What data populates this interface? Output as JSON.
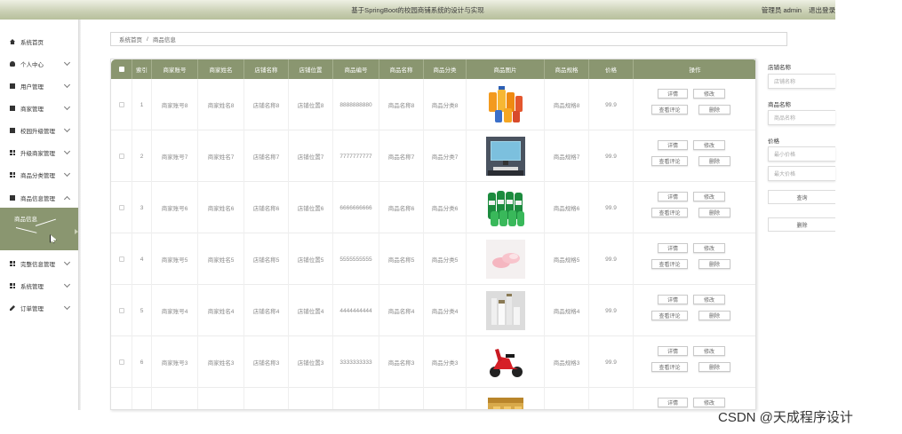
{
  "header": {
    "title": "基于SpringBoot的校园商铺系统的设计与实现",
    "user_label": "管理员 admin",
    "logout": "退出登录"
  },
  "sidebar": {
    "items": [
      {
        "label": "系统首页",
        "icon": "home-icon",
        "chevron": false
      },
      {
        "label": "个人中心",
        "icon": "person-icon",
        "chevron": true
      },
      {
        "label": "用户管理",
        "icon": "list-icon",
        "chevron": true
      },
      {
        "label": "商家管理",
        "icon": "store-icon",
        "chevron": true
      },
      {
        "label": "校园升级管理",
        "icon": "upgrade-icon",
        "chevron": true
      },
      {
        "label": "升级商家管理",
        "icon": "grid-icon",
        "chevron": true
      },
      {
        "label": "商品分类管理",
        "icon": "grid-icon",
        "chevron": true
      },
      {
        "label": "商品信息管理",
        "icon": "store-icon",
        "chevron": true
      },
      {
        "label": "完整信息管理",
        "icon": "grid-icon",
        "chevron": true
      },
      {
        "label": "系统管理",
        "icon": "grid-icon",
        "chevron": true
      },
      {
        "label": "订单管理",
        "icon": "pen-icon",
        "chevron": true
      }
    ],
    "submenu_label": "商品信息"
  },
  "breadcrumb": {
    "home": "系统首页",
    "separator": "/",
    "current": "商品信息"
  },
  "table": {
    "headers": [
      "索引",
      "商家账号",
      "商家姓名",
      "店铺名称",
      "店铺位置",
      "商品编号",
      "商品名称",
      "商品分类",
      "商品图片",
      "商品规格",
      "价格",
      "操作"
    ],
    "rows": [
      {
        "index": "1",
        "account": "商家账号8",
        "name": "商家姓名8",
        "shop": "店铺名称8",
        "location": "店铺位置8",
        "code": "8888888880",
        "product": "商品名称8",
        "category": "商品分类8",
        "image": "drinks",
        "spec": "商品规格8",
        "price": "99.9"
      },
      {
        "index": "2",
        "account": "商家账号7",
        "name": "商家姓名7",
        "shop": "店铺名称7",
        "location": "店铺位置7",
        "code": "7777777777",
        "product": "商品名称7",
        "category": "商品分类7",
        "image": "computer",
        "spec": "商品规格7",
        "price": "99.9"
      },
      {
        "index": "3",
        "account": "商家账号6",
        "name": "商家姓名6",
        "shop": "店铺名称6",
        "location": "店铺位置6",
        "code": "6666666666",
        "product": "商品名称6",
        "category": "商品分类6",
        "image": "bottles",
        "spec": "商品规格6",
        "price": "99.9"
      },
      {
        "index": "4",
        "account": "商家账号5",
        "name": "商家姓名5",
        "shop": "店铺名称5",
        "location": "店铺位置5",
        "code": "5555555555",
        "product": "商品名称5",
        "category": "商品分类5",
        "image": "slippers",
        "spec": "商品规格5",
        "price": "99.9"
      },
      {
        "index": "5",
        "account": "商家账号4",
        "name": "商家姓名4",
        "shop": "店铺名称4",
        "location": "店铺位置4",
        "code": "4444444444",
        "product": "商品名称4",
        "category": "商品分类4",
        "image": "cosmetics",
        "spec": "商品规格4",
        "price": "99.9"
      },
      {
        "index": "6",
        "account": "商家账号3",
        "name": "商家姓名3",
        "shop": "店铺名称3",
        "location": "店铺位置3",
        "code": "3333333333",
        "product": "商品名称3",
        "category": "商品分类3",
        "image": "scooter",
        "spec": "商品规格3",
        "price": "99.9"
      },
      {
        "index": "",
        "account": "",
        "name": "",
        "shop": "",
        "location": "",
        "code": "",
        "product": "",
        "category": "",
        "image": "boxes",
        "spec": "",
        "price": ""
      }
    ],
    "actions": {
      "detail": "详情",
      "edit": "修改",
      "comments": "查看评论",
      "delete": "删除"
    }
  },
  "filters": {
    "shop_label": "店铺名称",
    "shop_placeholder": "店铺名称",
    "product_label": "商品名称",
    "product_placeholder": "商品名称",
    "price_label": "价格",
    "min_placeholder": "最小价格",
    "max_placeholder": "最大价格",
    "search": "查询",
    "delete": "删除"
  },
  "watermark": "CSDN @天成程序设计",
  "colors": {
    "accent": "#8a9670",
    "header_gradient_top": "#eef0e4",
    "header_gradient_bottom": "#b7bf9c"
  }
}
